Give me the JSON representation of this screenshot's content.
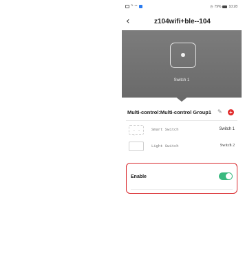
{
  "status_bar": {
    "signal": "ᵀᴸ ⁴⁶",
    "right": "79%",
    "time": "10:28"
  },
  "header": {
    "back_icon": "chevron-left-icon",
    "title": "z104wifi+ble--104"
  },
  "hero": {
    "switch_label": "Switch 1"
  },
  "group": {
    "title": "Multi-control:Multi-control Group1",
    "devices": [
      {
        "icon": "- - -",
        "name": "Smart Switch",
        "value": "Switch 1"
      },
      {
        "icon": "",
        "name": "Light Switch",
        "value": "Switch 2"
      }
    ]
  },
  "enable": {
    "label": "Enable",
    "on": true
  },
  "colors": {
    "hero_bg": "#6f6f6f",
    "toggle_on": "#39b97f",
    "highlight_border": "#d9262b",
    "add_button": "#e02a2a"
  }
}
